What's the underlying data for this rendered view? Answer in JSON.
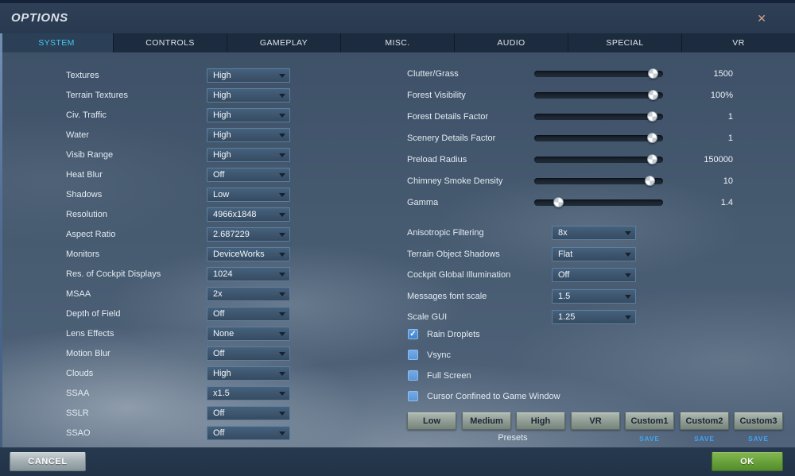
{
  "window": {
    "title": "OPTIONS",
    "close_icon": "✕"
  },
  "tabs": [
    {
      "label": "SYSTEM",
      "active": true
    },
    {
      "label": "CONTROLS",
      "active": false
    },
    {
      "label": "GAMEPLAY",
      "active": false
    },
    {
      "label": "MISC.",
      "active": false
    },
    {
      "label": "AUDIO",
      "active": false
    },
    {
      "label": "SPECIAL",
      "active": false
    },
    {
      "label": "VR",
      "active": false
    }
  ],
  "left_options": [
    {
      "label": "Textures",
      "value": "High"
    },
    {
      "label": "Terrain Textures",
      "value": "High"
    },
    {
      "label": "Civ. Traffic",
      "value": "High"
    },
    {
      "label": "Water",
      "value": "High"
    },
    {
      "label": "Visib Range",
      "value": "High"
    },
    {
      "label": "Heat Blur",
      "value": "Off"
    },
    {
      "label": "Shadows",
      "value": "Low"
    },
    {
      "label": "Resolution",
      "value": "4966x1848"
    },
    {
      "label": "Aspect Ratio",
      "value": "2.687229"
    },
    {
      "label": "Monitors",
      "value": "DeviceWorks"
    },
    {
      "label": "Res. of Cockpit Displays",
      "value": "1024"
    },
    {
      "label": "MSAA",
      "value": "2x"
    },
    {
      "label": "Depth of Field",
      "value": "Off"
    },
    {
      "label": "Lens Effects",
      "value": "None"
    },
    {
      "label": "Motion Blur",
      "value": "Off"
    },
    {
      "label": "Clouds",
      "value": "High"
    },
    {
      "label": "SSAA",
      "value": "x1.5"
    },
    {
      "label": "SSLR",
      "value": "Off"
    },
    {
      "label": "SSAO",
      "value": "Off"
    }
  ],
  "sliders": [
    {
      "label": "Clutter/Grass",
      "value": "1500",
      "percent": 96
    },
    {
      "label": "Forest Visibility",
      "value": "100%",
      "percent": 96
    },
    {
      "label": "Forest Details Factor",
      "value": "1",
      "percent": 95
    },
    {
      "label": "Scenery Details Factor",
      "value": "1",
      "percent": 95
    },
    {
      "label": "Preload Radius",
      "value": "150000",
      "percent": 95
    },
    {
      "label": "Chimney Smoke Density",
      "value": "10",
      "percent": 93
    },
    {
      "label": "Gamma",
      "value": "1.4",
      "percent": 16
    }
  ],
  "right_options": [
    {
      "label": "Anisotropic Filtering",
      "value": "8x"
    },
    {
      "label": "Terrain Object Shadows",
      "value": "Flat"
    },
    {
      "label": "Cockpit Global Illumination",
      "value": "Off"
    },
    {
      "label": "Messages font scale",
      "value": "1.5"
    },
    {
      "label": "Scale GUI",
      "value": "1.25"
    }
  ],
  "checkboxes": [
    {
      "label": "Rain Droplets",
      "checked": true
    },
    {
      "label": "Vsync",
      "checked": false
    },
    {
      "label": "Full Screen",
      "checked": false
    },
    {
      "label": "Cursor Confined to Game Window",
      "checked": false
    }
  ],
  "presets": {
    "caption": "Presets",
    "save_label": "SAVE",
    "check_glyph": "✓",
    "buttons": [
      {
        "label": "Low",
        "save": false
      },
      {
        "label": "Medium",
        "save": false
      },
      {
        "label": "High",
        "save": false
      },
      {
        "label": "VR",
        "save": false
      },
      {
        "label": "Custom1",
        "save": true
      },
      {
        "label": "Custom2",
        "save": true
      },
      {
        "label": "Custom3",
        "save": true
      }
    ]
  },
  "footer": {
    "cancel_label": "CANCEL",
    "ok_label": "OK"
  },
  "colors": {
    "accent_cyan": "#45c5f2",
    "save_link_blue": "#3ea5f4",
    "ok_green": "#69a23a",
    "checkbox_blue": "#4a8fd8",
    "titlebar": "#293a50",
    "tabbar": "#1c2b3e"
  }
}
